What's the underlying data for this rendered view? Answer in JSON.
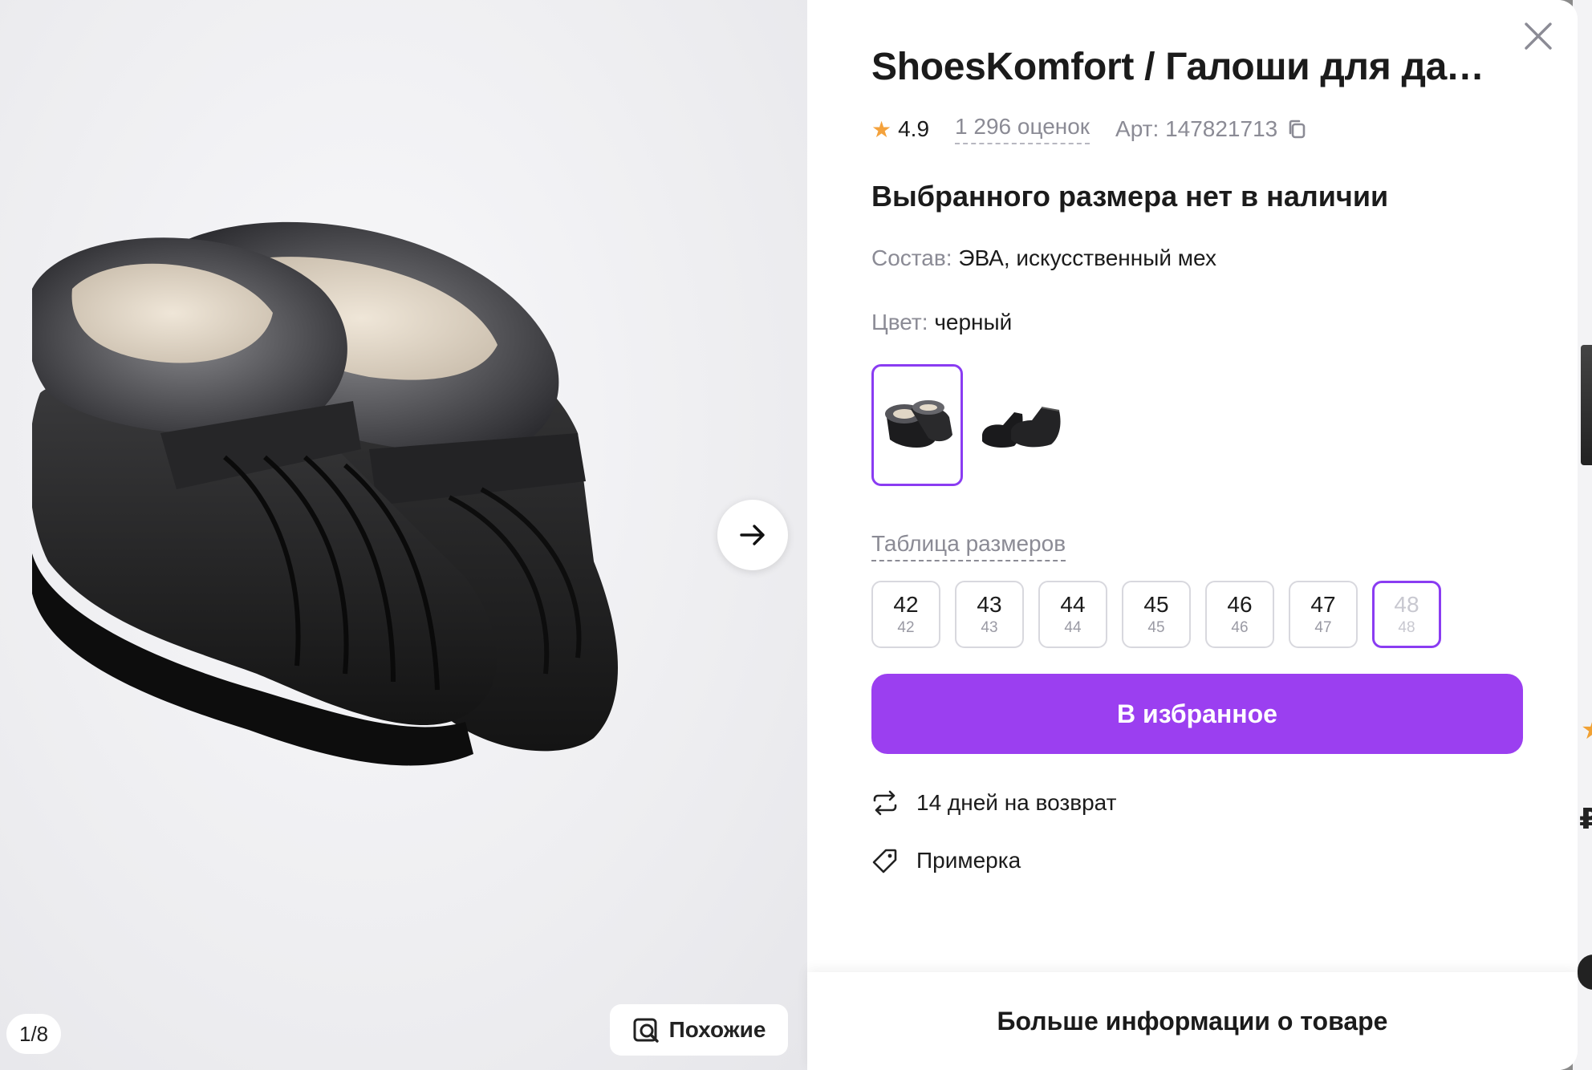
{
  "gallery": {
    "counter": "1/8",
    "similar_label": "Похожие"
  },
  "product": {
    "title": "ShoesKomfort / Галоши для дачи ...",
    "rating": "4.9",
    "reviews": "1 296 оценок",
    "article": "Арт: 147821713",
    "stock_message": "Выбранного размера нет в наличии",
    "composition_label": "Состав:",
    "composition_value": "ЭВА, искусственный мех",
    "color_label": "Цвет:",
    "color_value": "черный",
    "size_table_link": "Таблица размеров",
    "sizes": [
      {
        "label": "42",
        "ru": "42"
      },
      {
        "label": "43",
        "ru": "43"
      },
      {
        "label": "44",
        "ru": "44"
      },
      {
        "label": "45",
        "ru": "45"
      },
      {
        "label": "46",
        "ru": "46"
      },
      {
        "label": "47",
        "ru": "47"
      },
      {
        "label": "48",
        "ru": "48"
      }
    ],
    "favorite_button": "В избранное",
    "features": {
      "returns": "14 дней на возврат",
      "fitting": "Примерка"
    },
    "more_info": "Больше информации о товаре"
  },
  "colors": {
    "accent": "#9b3ff0",
    "selection": "#8a3cf2",
    "star": "#f4a23c"
  }
}
